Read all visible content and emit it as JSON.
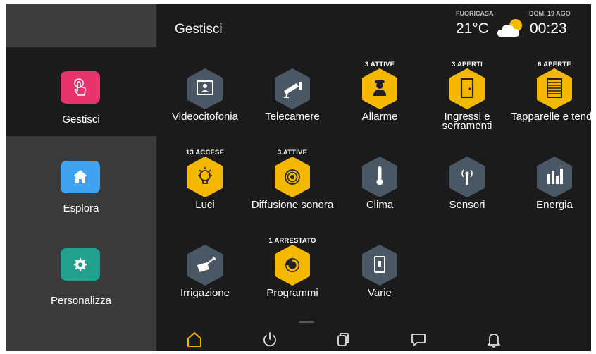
{
  "header": {
    "title": "Gestisci",
    "weather_label": "FUORICASA",
    "temperature": "21°C",
    "weather_icon": "partly-cloudy-icon",
    "date": "DOM. 19 AGO",
    "time": "00:23"
  },
  "sidebar": {
    "items": [
      {
        "label": "Gestisci",
        "icon": "touch-icon",
        "color": "#e8336d",
        "active": true
      },
      {
        "label": "Esplora",
        "icon": "home-icon",
        "color": "#3fa3f0",
        "active": false
      },
      {
        "label": "Personalizza",
        "icon": "gear-icon",
        "color": "#22a08e",
        "active": false
      }
    ]
  },
  "colors": {
    "active_hex": "#f5b800",
    "inactive_hex": "#4a5866",
    "background": "#1b1b1b",
    "sidebar": "#3a3a3a",
    "bottom_active": "#f5b800"
  },
  "functions": [
    {
      "label": "Videocitofonia",
      "badge": "",
      "icon": "video-intercom-icon",
      "active": false
    },
    {
      "label": "Telecamere",
      "badge": "",
      "icon": "camera-icon",
      "active": false
    },
    {
      "label": "Allarme",
      "badge": "3 ATTIVE",
      "icon": "alarm-guard-icon",
      "active": true
    },
    {
      "label": "Ingressi e serramenti",
      "badge": "3 APERTI",
      "icon": "door-icon",
      "active": true
    },
    {
      "label": "Tapparelle e tende",
      "badge": "6 APERTE",
      "icon": "shutter-icon",
      "active": true
    },
    {
      "label": "Luci",
      "badge": "13 ACCESE",
      "icon": "bulb-icon",
      "active": true
    },
    {
      "label": "Diffusione sonora",
      "badge": "3 ATTIVE",
      "icon": "speaker-icon",
      "active": true
    },
    {
      "label": "Clima",
      "badge": "",
      "icon": "thermometer-icon",
      "active": false
    },
    {
      "label": "Sensori",
      "badge": "",
      "icon": "sensor-icon",
      "active": false
    },
    {
      "label": "Energia",
      "badge": "",
      "icon": "energy-bars-icon",
      "active": false
    },
    {
      "label": "Irrigazione",
      "badge": "",
      "icon": "watering-can-icon",
      "active": false
    },
    {
      "label": "Programmi",
      "badge": "1 ARRESTATO",
      "icon": "program-icon",
      "active": true
    },
    {
      "label": "Varie",
      "badge": "",
      "icon": "misc-switch-icon",
      "active": false
    }
  ],
  "bottom_nav": [
    {
      "icon": "home-outline-icon",
      "active": true
    },
    {
      "icon": "power-icon",
      "active": false
    },
    {
      "icon": "scenarios-icon",
      "active": false
    },
    {
      "icon": "message-icon",
      "active": false
    },
    {
      "icon": "bell-icon",
      "active": false
    }
  ]
}
